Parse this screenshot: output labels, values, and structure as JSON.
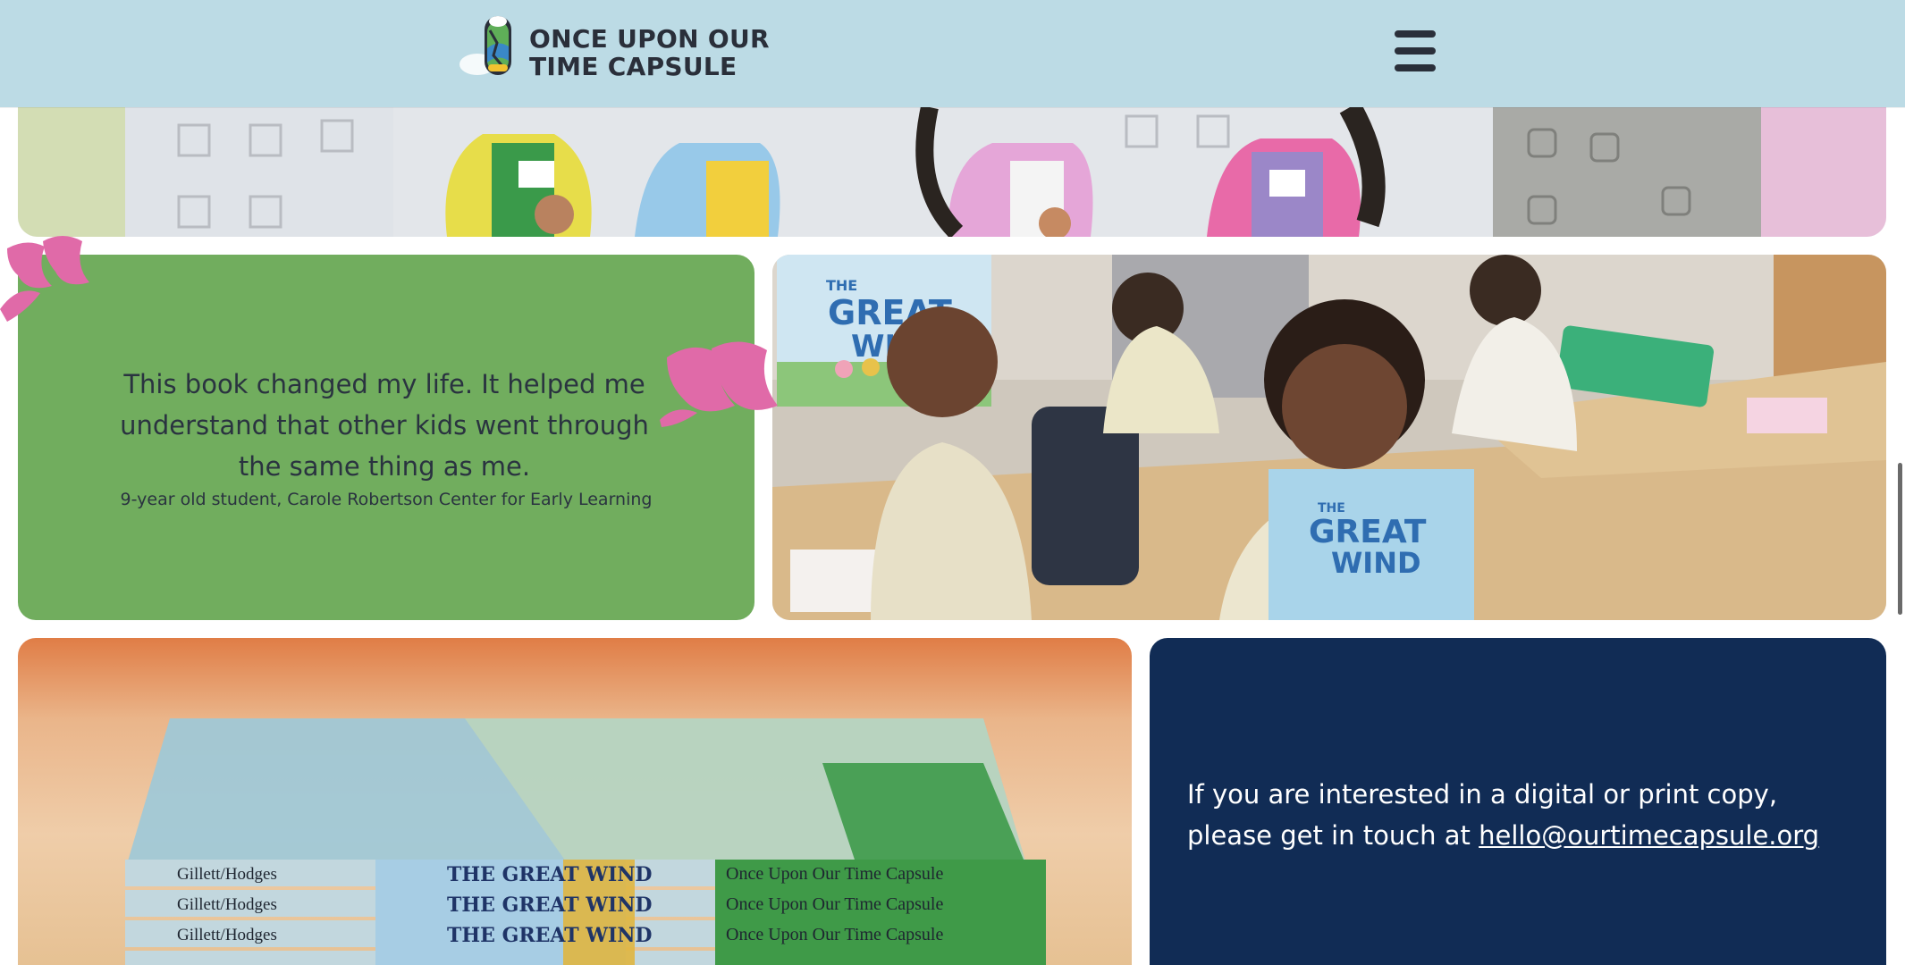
{
  "header": {
    "logo_line1": "ONCE UPON OUR",
    "logo_line2": "TIME CAPSULE",
    "menu_icon": "hamburger-menu-icon",
    "background": "#bcdbe5"
  },
  "testimonial": {
    "quote": "This book changed my life. It helped me understand that other kids went through the same thing as me.",
    "attribution": "9-year old student, Carole Robertson Center for Early Learning",
    "card_color": "#71ad5e",
    "quote_mark_color": "#e06aa8"
  },
  "class_photo": {
    "book_title_line1": "GREAT",
    "book_title_line2": "WIND",
    "book_the": "THE"
  },
  "books_photo": {
    "spine_author": "Gillett/Hodges",
    "spine_title": "THE GREAT WIND",
    "spine_series": "Once Upon Our Time Capsule"
  },
  "contact": {
    "text": "If you are interested in a digital or print copy, please get in touch at",
    "email": "hello@ourtimecapsule.org",
    "card_color": "#112c55"
  }
}
